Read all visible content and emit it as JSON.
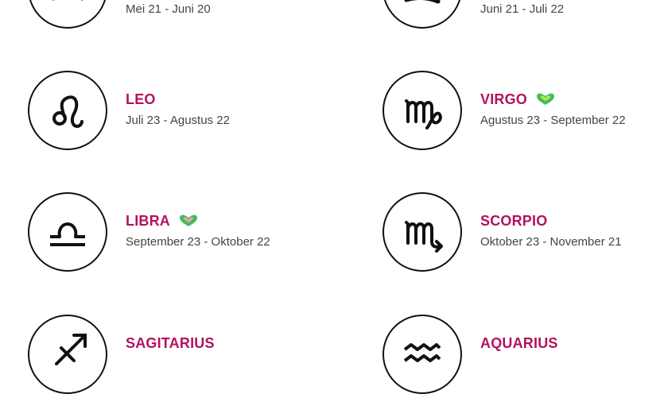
{
  "colors": {
    "accent": "#b3125f",
    "text": "#444444",
    "circle": "#111111",
    "heart_outer": "#3fbf5f",
    "heart_inner": "#e8a0a8"
  },
  "signs": [
    {
      "id": "cancer-partial",
      "name": "",
      "dates": "Mei 21 - Juni 20",
      "icon": "gemini-icon",
      "heart": false
    },
    {
      "id": "cancer",
      "name": "",
      "dates": "Juni 21 - Juli 22",
      "icon": "cancer-icon",
      "heart": false
    },
    {
      "id": "leo",
      "name": "LEO",
      "dates": "Juli 23 - Agustus 22",
      "icon": "leo-icon",
      "heart": false
    },
    {
      "id": "virgo",
      "name": "VIRGO",
      "dates": "Agustus 23 - September 22",
      "icon": "virgo-icon",
      "heart": true,
      "heart_icon": "green-heart-icon"
    },
    {
      "id": "libra",
      "name": "LIBRA",
      "dates": "September 23 - Oktober 22",
      "icon": "libra-icon",
      "heart": true,
      "heart_icon": "green-pink-heart-icon"
    },
    {
      "id": "scorpio",
      "name": "SCORPIO",
      "dates": "Oktober 23 - November 21",
      "icon": "scorpio-icon",
      "heart": false
    },
    {
      "id": "sagitarius",
      "name": "SAGITARIUS",
      "dates": "",
      "icon": "sagittarius-icon",
      "heart": false
    },
    {
      "id": "aquarius",
      "name": "AQUARIUS",
      "dates": "",
      "icon": "aquarius-icon",
      "heart": false
    }
  ]
}
